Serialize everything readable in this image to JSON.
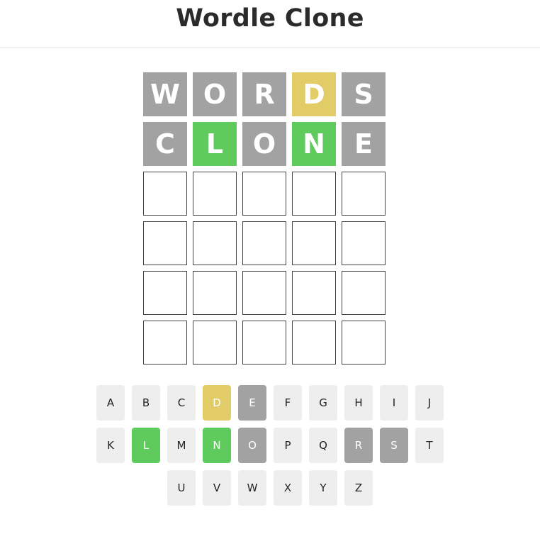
{
  "title": "Wordle Clone",
  "colors": {
    "absent": "#a2a2a2",
    "present": "#e2cc68",
    "correct": "#5ecb5c",
    "key_default": "#eeeeee"
  },
  "board": [
    [
      {
        "letter": "W",
        "state": "absent"
      },
      {
        "letter": "O",
        "state": "absent"
      },
      {
        "letter": "R",
        "state": "absent"
      },
      {
        "letter": "D",
        "state": "present"
      },
      {
        "letter": "S",
        "state": "absent"
      }
    ],
    [
      {
        "letter": "C",
        "state": "absent"
      },
      {
        "letter": "L",
        "state": "correct"
      },
      {
        "letter": "O",
        "state": "absent"
      },
      {
        "letter": "N",
        "state": "correct"
      },
      {
        "letter": "E",
        "state": "absent"
      }
    ],
    [
      {
        "letter": "",
        "state": "empty"
      },
      {
        "letter": "",
        "state": "empty"
      },
      {
        "letter": "",
        "state": "empty"
      },
      {
        "letter": "",
        "state": "empty"
      },
      {
        "letter": "",
        "state": "empty"
      }
    ],
    [
      {
        "letter": "",
        "state": "empty"
      },
      {
        "letter": "",
        "state": "empty"
      },
      {
        "letter": "",
        "state": "empty"
      },
      {
        "letter": "",
        "state": "empty"
      },
      {
        "letter": "",
        "state": "empty"
      }
    ],
    [
      {
        "letter": "",
        "state": "empty"
      },
      {
        "letter": "",
        "state": "empty"
      },
      {
        "letter": "",
        "state": "empty"
      },
      {
        "letter": "",
        "state": "empty"
      },
      {
        "letter": "",
        "state": "empty"
      }
    ],
    [
      {
        "letter": "",
        "state": "empty"
      },
      {
        "letter": "",
        "state": "empty"
      },
      {
        "letter": "",
        "state": "empty"
      },
      {
        "letter": "",
        "state": "empty"
      },
      {
        "letter": "",
        "state": "empty"
      }
    ]
  ],
  "keyboard": [
    [
      {
        "key": "A",
        "state": "default"
      },
      {
        "key": "B",
        "state": "default"
      },
      {
        "key": "C",
        "state": "default"
      },
      {
        "key": "D",
        "state": "present"
      },
      {
        "key": "E",
        "state": "absent"
      },
      {
        "key": "F",
        "state": "default"
      },
      {
        "key": "G",
        "state": "default"
      },
      {
        "key": "H",
        "state": "default"
      },
      {
        "key": "I",
        "state": "default"
      },
      {
        "key": "J",
        "state": "default"
      }
    ],
    [
      {
        "key": "K",
        "state": "default"
      },
      {
        "key": "L",
        "state": "correct"
      },
      {
        "key": "M",
        "state": "default"
      },
      {
        "key": "N",
        "state": "correct"
      },
      {
        "key": "O",
        "state": "absent"
      },
      {
        "key": "P",
        "state": "default"
      },
      {
        "key": "Q",
        "state": "default"
      },
      {
        "key": "R",
        "state": "absent"
      },
      {
        "key": "S",
        "state": "absent"
      },
      {
        "key": "T",
        "state": "default"
      }
    ],
    [
      {
        "key": "U",
        "state": "default"
      },
      {
        "key": "V",
        "state": "default"
      },
      {
        "key": "W",
        "state": "default"
      },
      {
        "key": "X",
        "state": "default"
      },
      {
        "key": "Y",
        "state": "default"
      },
      {
        "key": "Z",
        "state": "default"
      }
    ]
  ]
}
